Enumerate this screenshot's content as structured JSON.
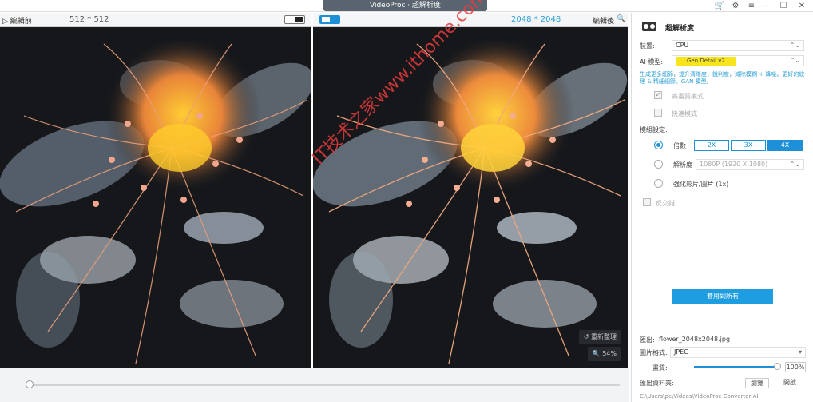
{
  "app": {
    "title": "VideoProc · 超解析度",
    "window_buttons": [
      "cart-icon",
      "settings-icon",
      "menu-icon",
      "minimize-icon",
      "maximize-icon",
      "close-icon"
    ]
  },
  "left_preview": {
    "label": "▷ 編輯前",
    "resolution": "512 * 512"
  },
  "right_preview": {
    "label": "編輯後",
    "resolution": "2048 * 2048",
    "reset_label": "重新整理",
    "zoom_label": "54%"
  },
  "watermark": "IT技术之家www.ithome.com",
  "panel": {
    "title": "超解析度",
    "device_label": "裝置:",
    "device_value": "CPU",
    "model_label": "AI 模型:",
    "model_value": "Gen Detail v2",
    "model_desc": "生成更多細節，提升清晰度，銳利度，減除模糊 + 降噪。更好的紋理 & 精細細節。GAN 模型。",
    "opt_high_quality": "高畫質模式",
    "opt_fast": "快速模式",
    "model_settings_label": "模組設定:",
    "scale_label": "倍數",
    "scale_options": [
      "2X",
      "3X",
      "4X"
    ],
    "scale_selected": "4X",
    "resolution_label": "解析度",
    "resolution_value": "1080P (1920 X 1080)",
    "enhance_label": "強化影片/圖片 (1x)",
    "reverse_label": "反交錯",
    "apply_button": "套用到所有",
    "export_label": "匯出:",
    "export_file": "flower_2048x2048.jpg",
    "format_label": "圖片格式:",
    "format_value": "JPEG",
    "quality_label": "畫質:",
    "quality_value": "100%",
    "folder_label": "匯出資料夾:",
    "browse_button": "瀏覽",
    "open_button": "開啟",
    "folder_path": "C:\\Users\\pc\\Videos\\VideoProc Converter AI"
  },
  "colors": {
    "accent": "#1e90d8",
    "model_chip": "#f7e41c",
    "watermark": "#e63c3c"
  }
}
